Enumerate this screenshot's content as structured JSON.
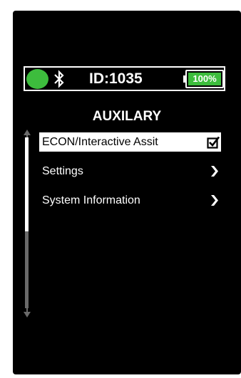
{
  "status_bar": {
    "connection_icon": "green-circle-indicator",
    "bluetooth_icon": "bluetooth-icon",
    "device_id": "ID:1035",
    "battery_level": 1.0,
    "battery_text": "100%"
  },
  "menu": {
    "title": "AUXILARY",
    "items": [
      {
        "label": "ECON/Interactive Assit",
        "icon": "checkbox-checked-icon",
        "selected": true
      },
      {
        "label": "Settings",
        "icon": "chevron-right-icon",
        "selected": false
      },
      {
        "label": "System Information",
        "icon": "chevron-right-icon",
        "selected": false
      }
    ]
  },
  "scrollbar": {
    "up_icon": "arrow-up-icon",
    "down_icon": "arrow-down-icon",
    "thumb_fraction": 0.55
  },
  "colors": {
    "background": "#000000",
    "accent_green": "#3dbd3d",
    "text": "#ffffff",
    "scroll_track": "#6a6a6a"
  }
}
